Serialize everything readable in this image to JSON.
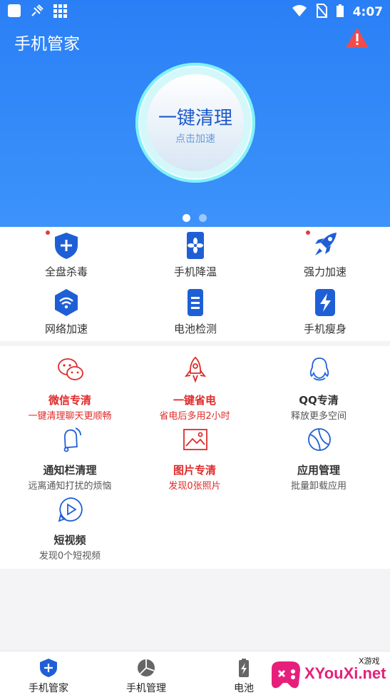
{
  "status_bar": {
    "time": "4:07"
  },
  "app_title": "手机管家",
  "clean_button": {
    "title": "一键清理",
    "subtitle": "点击加速"
  },
  "tools": [
    {
      "label": "全盘杀毒",
      "icon": "shield-plus-icon",
      "has_dot": true
    },
    {
      "label": "手机降温",
      "icon": "phone-fan-icon",
      "has_dot": false
    },
    {
      "label": "强力加速",
      "icon": "rocket-icon",
      "has_dot": true
    },
    {
      "label": "网络加速",
      "icon": "wifi-hex-icon",
      "has_dot": false
    },
    {
      "label": "电池检测",
      "icon": "battery-list-icon",
      "has_dot": false
    },
    {
      "label": "手机瘦身",
      "icon": "lightning-icon",
      "has_dot": false
    }
  ],
  "features": [
    {
      "title": "微信专清",
      "subtitle": "一键清理聊天更顺畅",
      "icon": "wechat-icon",
      "highlight": true
    },
    {
      "title": "一键省电",
      "subtitle": "省电后多用2小时",
      "icon": "rocket-outline-icon",
      "highlight": true
    },
    {
      "title": "QQ专清",
      "subtitle": "释放更多空间",
      "icon": "qq-icon",
      "highlight": false
    },
    {
      "title": "通知栏清理",
      "subtitle": "远离通知打扰的烦恼",
      "icon": "bell-icon",
      "highlight": false
    },
    {
      "title": "图片专清",
      "subtitle": "发现0张照片",
      "icon": "picture-icon",
      "highlight": true
    },
    {
      "title": "应用管理",
      "subtitle": "批量卸载应用",
      "icon": "apps-globe-icon",
      "highlight": false
    },
    {
      "title": "短视频",
      "subtitle": "发现0个短视频",
      "icon": "video-play-icon",
      "highlight": false
    }
  ],
  "bottom_nav": [
    {
      "label": "手机管家",
      "icon": "shield-plus-icon"
    },
    {
      "label": "手机管理",
      "icon": "pie-icon"
    },
    {
      "label": "电池",
      "icon": "battery-icon"
    }
  ],
  "watermark": {
    "text": "XYouXi.net",
    "tag": "X游戏"
  },
  "colors": {
    "primary": "#2a7ff6",
    "highlight_red": "#e02a2a",
    "icon_blue": "#1f5fd6"
  }
}
